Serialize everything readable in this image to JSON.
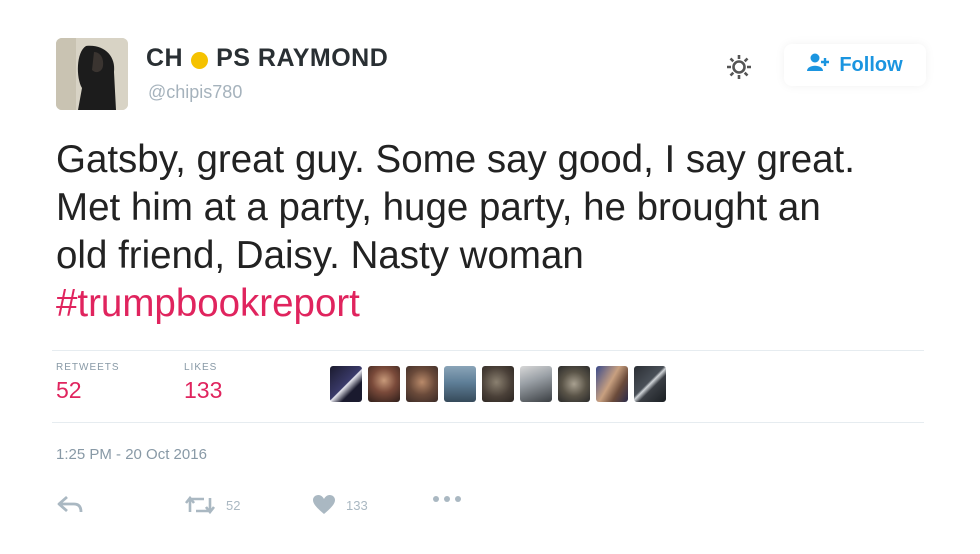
{
  "user": {
    "display_name_left": "CH",
    "display_name_right": "PS RAYMOND",
    "handle": "@chipis780"
  },
  "header": {
    "follow_label": "Follow"
  },
  "tweet": {
    "text_line_1": "Gatsby, great guy. Some say good, I say great.",
    "text_line_2": "Met him at a party, huge party, he brought an",
    "text_line_3": "old friend, Daisy. Nasty woman",
    "hashtag": "#trumpbookreport"
  },
  "stats": {
    "retweets_label": "RETWEETS",
    "retweets_value": "52",
    "likes_label": "LIKES",
    "likes_value": "133"
  },
  "timestamp": "1:25 PM - 20 Oct 2016",
  "actions": {
    "retweet_count": "52",
    "like_count": "133"
  },
  "colors": {
    "accent_blue": "#1b95e0",
    "hashtag_pink": "#e0245e",
    "name_dot_yellow": "#f5c200",
    "muted_gray": "#8899a6"
  },
  "icons": {
    "settings": "gear-icon",
    "follow": "add-user-icon",
    "reply": "reply-icon",
    "retweet": "retweet-icon",
    "like": "heart-icon",
    "more": "more-dots-icon"
  }
}
